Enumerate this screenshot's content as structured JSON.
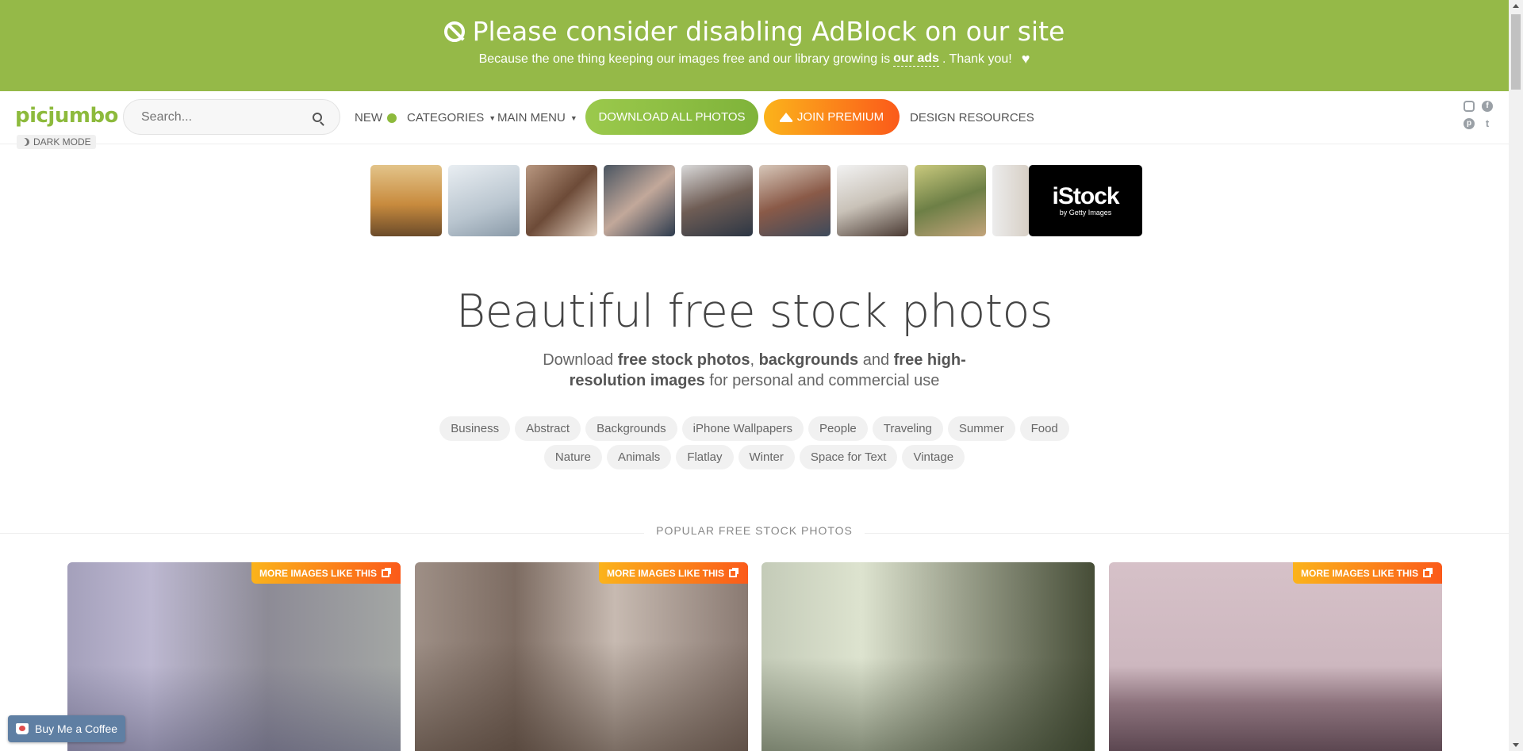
{
  "adblock": {
    "title": "Please consider disabling AdBlock on our site",
    "sub_before": "Because the one thing keeping our images free and our library growing is",
    "sub_bold": "our ads",
    "sub_after": ". Thank you!"
  },
  "nav": {
    "logo": "picjumbo",
    "dark_mode": "DARK MODE",
    "search_placeholder": "Search...",
    "new": "NEW",
    "categories": "CATEGORIES",
    "main_menu": "MAIN MENU",
    "download_all": "DOWNLOAD ALL PHOTOS",
    "join_premium": "JOIN PREMIUM",
    "design_resources": "DESIGN RESOURCES",
    "social": [
      "instagram-icon",
      "facebook-icon",
      "pinterest-icon",
      "twitter-icon"
    ]
  },
  "istock": {
    "brand": "iStock",
    "by": "by Getty Images"
  },
  "hero": {
    "title": "Beautiful free stock photos",
    "lead_1": "Download ",
    "lead_b1": "free stock photos",
    "lead_2": ", ",
    "lead_b2": "backgrounds",
    "lead_3": " and ",
    "lead_b3": "free high-resolution images",
    "lead_4": " for personal and commercial use"
  },
  "tags_row1": [
    "Business",
    "Abstract",
    "Backgrounds",
    "iPhone Wallpapers",
    "People",
    "Traveling",
    "Summer",
    "Food"
  ],
  "tags_row2": [
    "Nature",
    "Animals",
    "Flatlay",
    "Winter",
    "Space for Text",
    "Vintage"
  ],
  "popular_label": "POPULAR FREE STOCK PHOTOS",
  "more_label": "MORE IMAGES LIKE THIS",
  "coffee": "Buy Me a Coffee",
  "colors": {
    "brand_green": "#95b948",
    "premium_orange": "#fb5a1a",
    "premium_yellow": "#fbb31b"
  }
}
